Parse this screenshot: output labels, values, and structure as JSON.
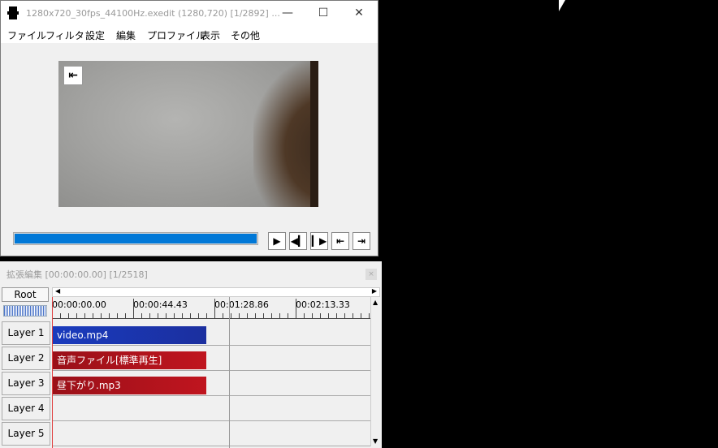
{
  "window": {
    "title": "1280x720_30fps_44100Hz.exedit (1280,720)  [1/2892]  ...",
    "minimize": "—",
    "maximize": "☐",
    "close": "✕"
  },
  "menu": [
    "ファイル",
    "フィルタ",
    "設定",
    "編集",
    "プロファイル",
    "表示",
    "その他"
  ],
  "player": {
    "seek_progress": 0.0,
    "buttons": [
      "▶",
      "◀▎",
      "▎▶",
      "⇤",
      "⇥"
    ]
  },
  "timeline": {
    "title": "拡張編集 [00:00:00.00] [1/2518]",
    "close": "×",
    "root_label": "Root",
    "ruler_labels": [
      "00:00:00.00",
      "00:00:44.43",
      "00:01:28.86",
      "00:02:13.33"
    ],
    "layers": [
      {
        "label": "Layer 1",
        "clip": "video.mp4",
        "color": "#1a3bbd"
      },
      {
        "label": "Layer 2",
        "clip": "音声ファイル[標準再生]",
        "color": "#c0151f"
      },
      {
        "label": "Layer 3",
        "clip": "昼下がり.mp3",
        "color": "#c0151f"
      },
      {
        "label": "Layer 4",
        "clip": "",
        "color": ""
      },
      {
        "label": "Layer 5",
        "clip": "",
        "color": ""
      }
    ]
  }
}
